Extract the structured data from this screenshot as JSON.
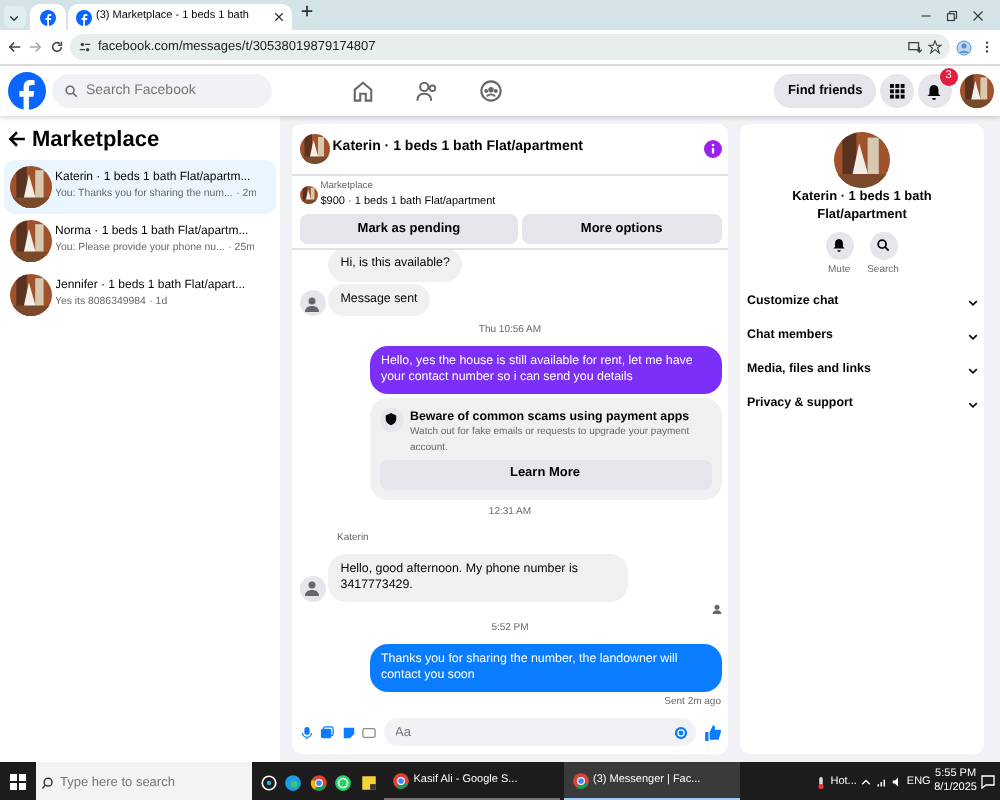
{
  "browser": {
    "tabs": [
      {
        "title": "(3) Marketplace - 1 beds 1 bath",
        "selected": true
      }
    ],
    "url": "facebook.com/messages/t/30538019879174807"
  },
  "header": {
    "search_placeholder": "Search Facebook",
    "find_friends": "Find friends",
    "notification_count": "3"
  },
  "sidebar": {
    "title": "Marketplace",
    "conversations": [
      {
        "name": "Katerin · 1 beds 1 bath Flat/apartm...",
        "preview": "You: Thanks you for sharing the num...",
        "time": "· 2m",
        "selected": true
      },
      {
        "name": "Norma · 1 beds 1 bath Flat/apartm...",
        "preview": "You: Please provide your phone nu...",
        "time": "· 25m",
        "selected": false
      },
      {
        "name": "Jennifer · 1 beds 1 bath Flat/apart...",
        "preview": "Yes its 8086349984",
        "time": "· 1d",
        "selected": false
      }
    ]
  },
  "chat": {
    "title": "Katerin · 1 beds 1 bath Flat/apartment",
    "listing_label": "Marketplace",
    "listing": "$900 · 1 beds 1 bath Flat/apartment",
    "actions": [
      "Mark as pending",
      "More options"
    ],
    "messages": [
      {
        "kind": "incoming",
        "text": "Hi, is this available?",
        "avatar": false
      },
      {
        "kind": "incoming",
        "text": "Message sent",
        "avatar": true
      },
      {
        "kind": "timestamp",
        "text": "Thu 10:56 AM"
      },
      {
        "kind": "outgoing",
        "text": "Hello, yes the house is still available for rent, let me have your contact number so i can send you details"
      },
      {
        "kind": "warning",
        "title": "Beware of common scams using payment apps",
        "body": "Watch out for fake emails or requests to upgrade your payment account.",
        "button": "Learn More"
      },
      {
        "kind": "timestamp",
        "text": "12:31 AM"
      },
      {
        "kind": "sender",
        "text": "Katerin"
      },
      {
        "kind": "incoming",
        "text": "Hello, good afternoon. My phone number is 3417773429.",
        "avatar": true
      },
      {
        "kind": "receipt"
      },
      {
        "kind": "timestamp",
        "text": "5:52 PM"
      },
      {
        "kind": "outgoing",
        "text": "Thanks you for sharing the number, the landowner will contact you soon"
      },
      {
        "kind": "status",
        "text": "Sent 2m ago"
      }
    ],
    "composer_placeholder": "Aa"
  },
  "details": {
    "name": "Katerin · 1 beds 1 bath Flat/apartment",
    "actions": [
      {
        "kind": "mute",
        "label": "Mute"
      },
      {
        "kind": "search",
        "label": "Search"
      }
    ],
    "sections": [
      "Customize chat",
      "Chat members",
      "Media, files and links",
      "Privacy & support"
    ]
  },
  "taskbar": {
    "search_placeholder": "Type here to search",
    "apps": [
      {
        "title": "Kasif Ali - Google S...",
        "selected": false
      },
      {
        "title": "(3) Messenger | Fac...",
        "selected": true
      }
    ],
    "weather": "Hot...",
    "language": "ENG",
    "time": "5:55 PM",
    "date": "8/1/2025"
  }
}
